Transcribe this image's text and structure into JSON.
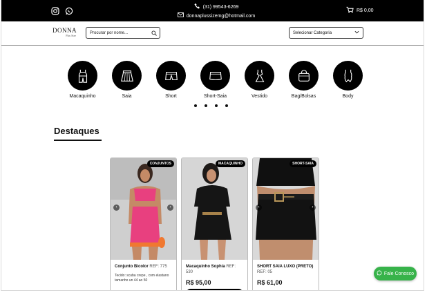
{
  "topbar": {
    "phone": "(31) 99543-6269",
    "email": "donnaplussizemg@hotmail.com",
    "cart_total": "R$ 0,00"
  },
  "header": {
    "logo_main": "DONNA",
    "logo_sub": "Plus Size",
    "search_placeholder": "Procurar por nome...",
    "category_select": "Selecionar Categoria"
  },
  "categories": [
    {
      "label": "Macaquinho",
      "icon": "jumpsuit-icon"
    },
    {
      "label": "Saia",
      "icon": "skirt-icon"
    },
    {
      "label": "Short",
      "icon": "shorts-icon"
    },
    {
      "label": "Short-Saia",
      "icon": "skort-icon"
    },
    {
      "label": "Vestido",
      "icon": "dress-icon"
    },
    {
      "label": "Bag/Bolsas",
      "icon": "bag-icon"
    },
    {
      "label": "Body",
      "icon": "bodysuit-icon"
    }
  ],
  "highlights": {
    "title": "Destaques",
    "products": [
      {
        "badge": "CONJUNTOS",
        "name": "Conjunto Bicolor",
        "ref": "REF: 775",
        "desc": "Tecido: scuba crepe , com elastano tamanho un 44 ao 50",
        "price": ""
      },
      {
        "badge": "MACAQUINHO",
        "name": "Macaquinho Sophia",
        "ref": "REF: 530",
        "desc": "",
        "price": "R$ 95,00"
      },
      {
        "badge": "SHORT-SAIA",
        "name": "SHORT SAIA LUXO (PRETO)",
        "ref": "REF: 05",
        "desc": "",
        "price": "R$ 61,00"
      }
    ]
  },
  "fab": {
    "label": "Fale Conosco"
  },
  "colors": {
    "topbar": "#000000",
    "whatsapp_button": "#37b34a",
    "card_pink": "#e8407f",
    "card_black": "#111111"
  }
}
